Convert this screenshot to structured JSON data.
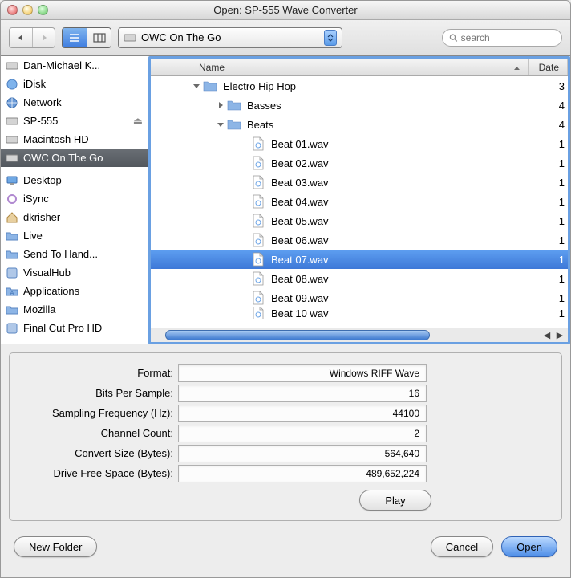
{
  "window": {
    "title": "Open: SP-555 Wave Converter"
  },
  "toolbar": {
    "location": "OWC On The Go",
    "search_placeholder": "search"
  },
  "sidebar": {
    "items": [
      {
        "id": "dan-michael",
        "label": "Dan-Michael K...",
        "icon": "disk"
      },
      {
        "id": "idisk",
        "label": "iDisk",
        "icon": "idisk"
      },
      {
        "id": "network",
        "label": "Network",
        "icon": "network"
      },
      {
        "id": "sp555",
        "label": "SP-555",
        "icon": "disk",
        "eject": true
      },
      {
        "id": "macintosh-hd",
        "label": "Macintosh HD",
        "icon": "disk"
      },
      {
        "id": "owc",
        "label": "OWC On The Go",
        "icon": "disk",
        "selected": true
      }
    ],
    "items2": [
      {
        "id": "desktop",
        "label": "Desktop",
        "icon": "desktop"
      },
      {
        "id": "isync",
        "label": "iSync",
        "icon": "sync"
      },
      {
        "id": "dkrisher",
        "label": "dkrisher",
        "icon": "home"
      },
      {
        "id": "live",
        "label": "Live",
        "icon": "folder"
      },
      {
        "id": "sendto",
        "label": "Send To Hand...",
        "icon": "folder"
      },
      {
        "id": "visualhub",
        "label": "VisualHub",
        "icon": "app"
      },
      {
        "id": "applications",
        "label": "Applications",
        "icon": "app-folder"
      },
      {
        "id": "mozilla",
        "label": "Mozilla",
        "icon": "folder"
      },
      {
        "id": "finalcut",
        "label": "Final Cut Pro HD",
        "icon": "app"
      }
    ]
  },
  "columns": {
    "name": "Name",
    "date": "Date"
  },
  "files": [
    {
      "indent": 1,
      "type": "folder",
      "name": "Electro Hip Hop",
      "date": "3",
      "expanded": true,
      "arrow": "down"
    },
    {
      "indent": 2,
      "type": "folder",
      "name": "Basses",
      "date": "4",
      "arrow": "right"
    },
    {
      "indent": 2,
      "type": "folder",
      "name": "Beats",
      "date": "4",
      "expanded": true,
      "arrow": "down"
    },
    {
      "indent": 3,
      "type": "file",
      "name": "Beat 01.wav",
      "date": "1"
    },
    {
      "indent": 3,
      "type": "file",
      "name": "Beat 02.wav",
      "date": "1"
    },
    {
      "indent": 3,
      "type": "file",
      "name": "Beat 03.wav",
      "date": "1"
    },
    {
      "indent": 3,
      "type": "file",
      "name": "Beat 04.wav",
      "date": "1"
    },
    {
      "indent": 3,
      "type": "file",
      "name": "Beat 05.wav",
      "date": "1"
    },
    {
      "indent": 3,
      "type": "file",
      "name": "Beat 06.wav",
      "date": "1"
    },
    {
      "indent": 3,
      "type": "file",
      "name": "Beat 07.wav",
      "date": "1",
      "selected": true
    },
    {
      "indent": 3,
      "type": "file",
      "name": "Beat 08.wav",
      "date": "1"
    },
    {
      "indent": 3,
      "type": "file",
      "name": "Beat 09.wav",
      "date": "1"
    },
    {
      "indent": 3,
      "type": "file",
      "name": "Beat 10 wav",
      "date": "1",
      "cut": true
    }
  ],
  "info": {
    "format_label": "Format:",
    "format_value": "Windows RIFF Wave",
    "bits_label": "Bits Per Sample:",
    "bits_value": "16",
    "freq_label": "Sampling Frequency (Hz):",
    "freq_value": "44100",
    "channels_label": "Channel Count:",
    "channels_value": "2",
    "size_label": "Convert Size (Bytes):",
    "size_value": "564,640",
    "free_label": "Drive Free Space (Bytes):",
    "free_value": "489,652,224",
    "play": "Play"
  },
  "buttons": {
    "new_folder": "New Folder",
    "cancel": "Cancel",
    "open": "Open"
  }
}
